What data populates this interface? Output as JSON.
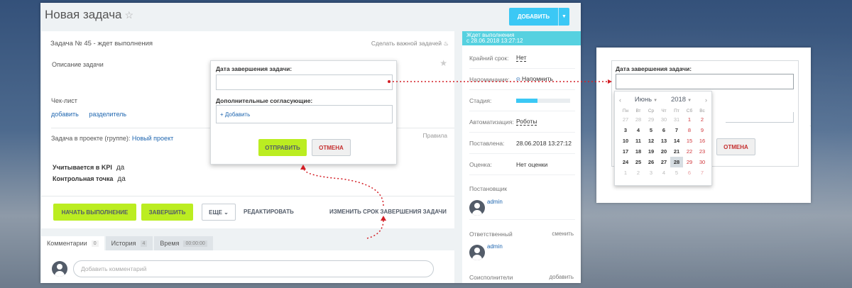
{
  "window": {
    "title": "Новая задача",
    "add_button": "ДОБАВИТЬ"
  },
  "task": {
    "header": "Задача № 45 - ждет выполнения",
    "make_important": "Сделать важной задачей",
    "description_label": "Описание задачи",
    "checklist_label": "Чек-лист",
    "checklist_add": "добавить",
    "checklist_separator": "разделитель",
    "project_label": "Задача в проекте (группе):",
    "project_name": "Новый проект",
    "rules_label": "Правила",
    "kpi_label": "Учитывается в KPI",
    "kpi_value": "да",
    "checkpoint_label": "Контрольная точка",
    "checkpoint_value": "да"
  },
  "actions": {
    "start": "НАЧАТЬ ВЫПОЛНЕНИЕ",
    "finish": "ЗАВЕРШИТЬ",
    "more": "ЕЩЕ",
    "edit": "РЕДАКТИРОВАТЬ",
    "change_deadline": "ИЗМЕНИТЬ СРОК ЗАВЕРШЕНИЯ ЗАДАЧИ"
  },
  "tabs": [
    {
      "label": "Комментарии",
      "count": "0"
    },
    {
      "label": "История",
      "count": "4"
    },
    {
      "label": "Время",
      "count": "00:00:00"
    }
  ],
  "comment": {
    "placeholder": "Добавить комментарий"
  },
  "sidebar": {
    "status_line1": "Ждет выполнения",
    "status_line2": "с 28.06.2018 13:27:12",
    "deadline_label": "Крайний срок:",
    "deadline_value": "Нет",
    "reminder_label": "Напоминание:",
    "reminder_value": "Напомнить",
    "stage_label": "Стадия:",
    "stage_progress": 0.4,
    "automation_label": "Автоматизация:",
    "automation_value": "Роботы",
    "created_label": "Поставлена:",
    "created_value": "28.06.2018 13:27:12",
    "rating_label": "Оценка:",
    "rating_value": "Нет оценки",
    "creator_label": "Постановщик",
    "creator_name": "admin",
    "responsible_label": "Ответственный",
    "responsible_change": "сменить",
    "responsible_name": "admin",
    "coexecutors_label": "Соисполнители",
    "coexecutors_add": "добавить"
  },
  "popup": {
    "deadline_label": "Дата завершения задачи:",
    "approvers_label": "Дополнительные согласующие:",
    "add_label": "+ Добавить",
    "send": "ОТПРАВИТЬ",
    "cancel": "ОТМЕНА"
  },
  "calendar": {
    "month": "Июнь",
    "year": "2018",
    "weekdays": [
      "Пн",
      "Вт",
      "Ср",
      "Чт",
      "Пт",
      "Сб",
      "Вс"
    ],
    "weeks": [
      [
        "28",
        "29",
        "30",
        "31",
        "1",
        "2",
        "3"
      ],
      [
        "4",
        "5",
        "6",
        "7",
        "8",
        "9",
        "10"
      ],
      [
        "11",
        "12",
        "13",
        "14",
        "15",
        "16",
        "17"
      ],
      [
        "18",
        "19",
        "20",
        "21",
        "22",
        "23",
        "24"
      ],
      [
        "25",
        "26",
        "27",
        "28",
        "29",
        "30",
        "1"
      ],
      [
        "2",
        "3",
        "4",
        "5",
        "6",
        "7",
        "8"
      ]
    ],
    "weeks_visible": [
      [
        "27",
        "28",
        "29",
        "30",
        "31",
        "1",
        "2"
      ],
      [
        "3",
        "4",
        "5",
        "6",
        "7",
        "8",
        "9"
      ],
      [
        "10",
        "11",
        "12",
        "13",
        "14",
        "15",
        "16"
      ],
      [
        "17",
        "18",
        "19",
        "20",
        "21",
        "22",
        "23"
      ],
      [
        "24",
        "25",
        "26",
        "27",
        "28",
        "29",
        "30"
      ],
      [
        "1",
        "2",
        "3",
        "4",
        "5",
        "6",
        "7"
      ]
    ],
    "today": "28"
  },
  "colors": {
    "accent_blue": "#3bc8f5",
    "accent_green": "#bbed21",
    "cancel_red": "#c52e2e",
    "status_teal": "#56d1e0"
  }
}
